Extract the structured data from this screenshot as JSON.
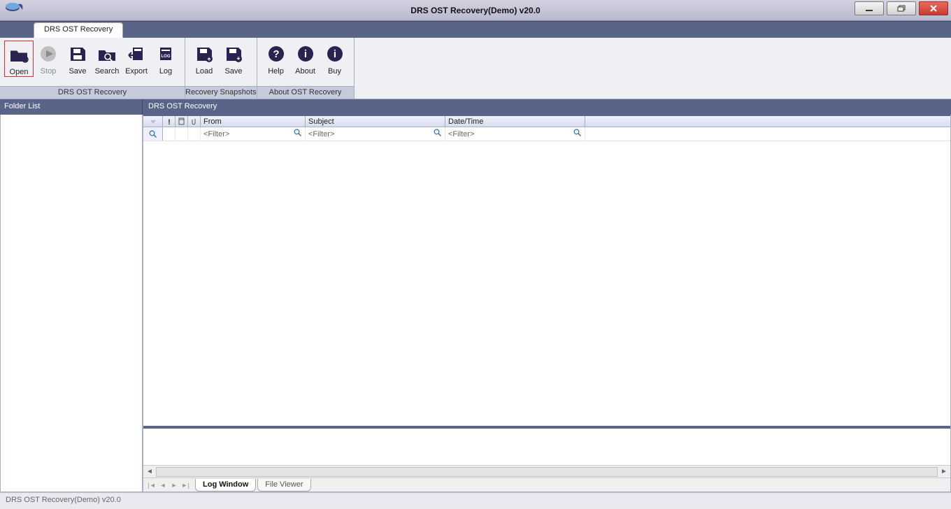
{
  "window": {
    "title": "DRS OST Recovery(Demo) v20.0",
    "min_tooltip": "Minimize",
    "restore_tooltip": "Restore",
    "close_tooltip": "Close"
  },
  "tabstrip": {
    "active_tab": "DRS OST Recovery"
  },
  "ribbon": {
    "groups": [
      {
        "label": "DRS OST Recovery",
        "buttons": [
          {
            "key": "open",
            "label": "Open"
          },
          {
            "key": "stop",
            "label": "Stop",
            "disabled": true
          },
          {
            "key": "save",
            "label": "Save"
          },
          {
            "key": "search",
            "label": "Search"
          },
          {
            "key": "export",
            "label": "Export"
          },
          {
            "key": "log",
            "label": "Log"
          }
        ]
      },
      {
        "label": "Recovery Snapshots",
        "buttons": [
          {
            "key": "load",
            "label": "Load"
          },
          {
            "key": "save2",
            "label": "Save"
          }
        ]
      },
      {
        "label": "About OST Recovery",
        "buttons": [
          {
            "key": "help",
            "label": "Help"
          },
          {
            "key": "about",
            "label": "About"
          },
          {
            "key": "buy",
            "label": "Buy"
          }
        ]
      }
    ]
  },
  "panels": {
    "folder_list_header": "Folder List",
    "content_header": "DRS OST Recovery"
  },
  "grid": {
    "columns": {
      "from": "From",
      "subject": "Subject",
      "datetime": "Date/Time"
    },
    "filter_placeholder": "<Filter>"
  },
  "lower_tabs": {
    "log_window": "Log Window",
    "file_viewer": "File Viewer"
  },
  "statusbar": {
    "text": "DRS OST Recovery(Demo) v20.0"
  },
  "icons": {
    "search_hint": "search"
  }
}
